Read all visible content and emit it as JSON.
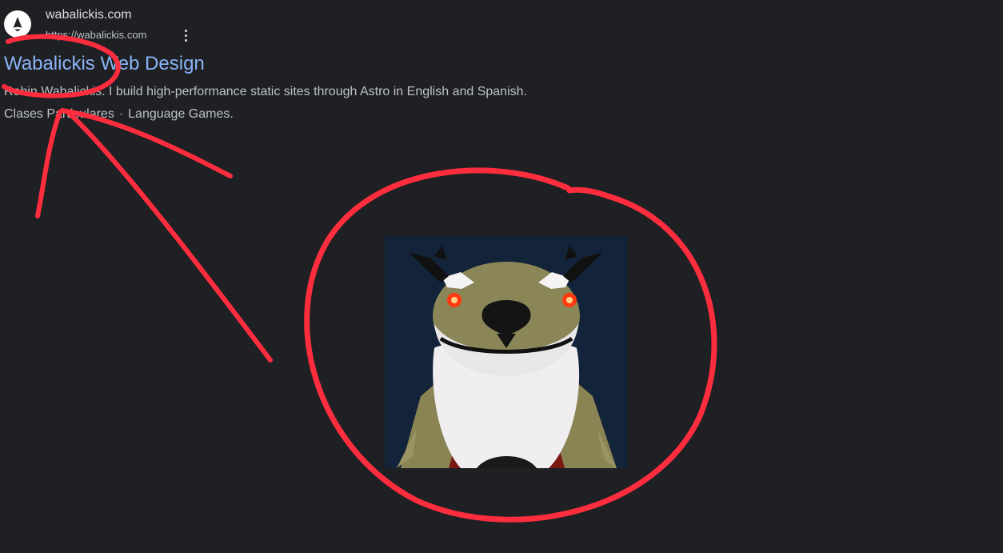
{
  "result": {
    "site_name": "wabalickis.com",
    "site_url": "https://wabalickis.com",
    "title": "Wabalickis Web Design",
    "snippet": "Robin Wabalickis. I build high-performance static sites through Astro in English and Spanish.",
    "sitelinks": [
      "Clases Particulares",
      "Language Games."
    ],
    "sitelink_separator": "·",
    "favicon_icon": "astro-logo-icon",
    "more_icon": "more-vert-icon"
  },
  "colors": {
    "background": "#1f2023",
    "link": "#8ab4f8",
    "text": "#bdc1c6",
    "annotation": "#ff2d3d"
  },
  "image": {
    "subject": "3d-avatar-creature-icon"
  }
}
